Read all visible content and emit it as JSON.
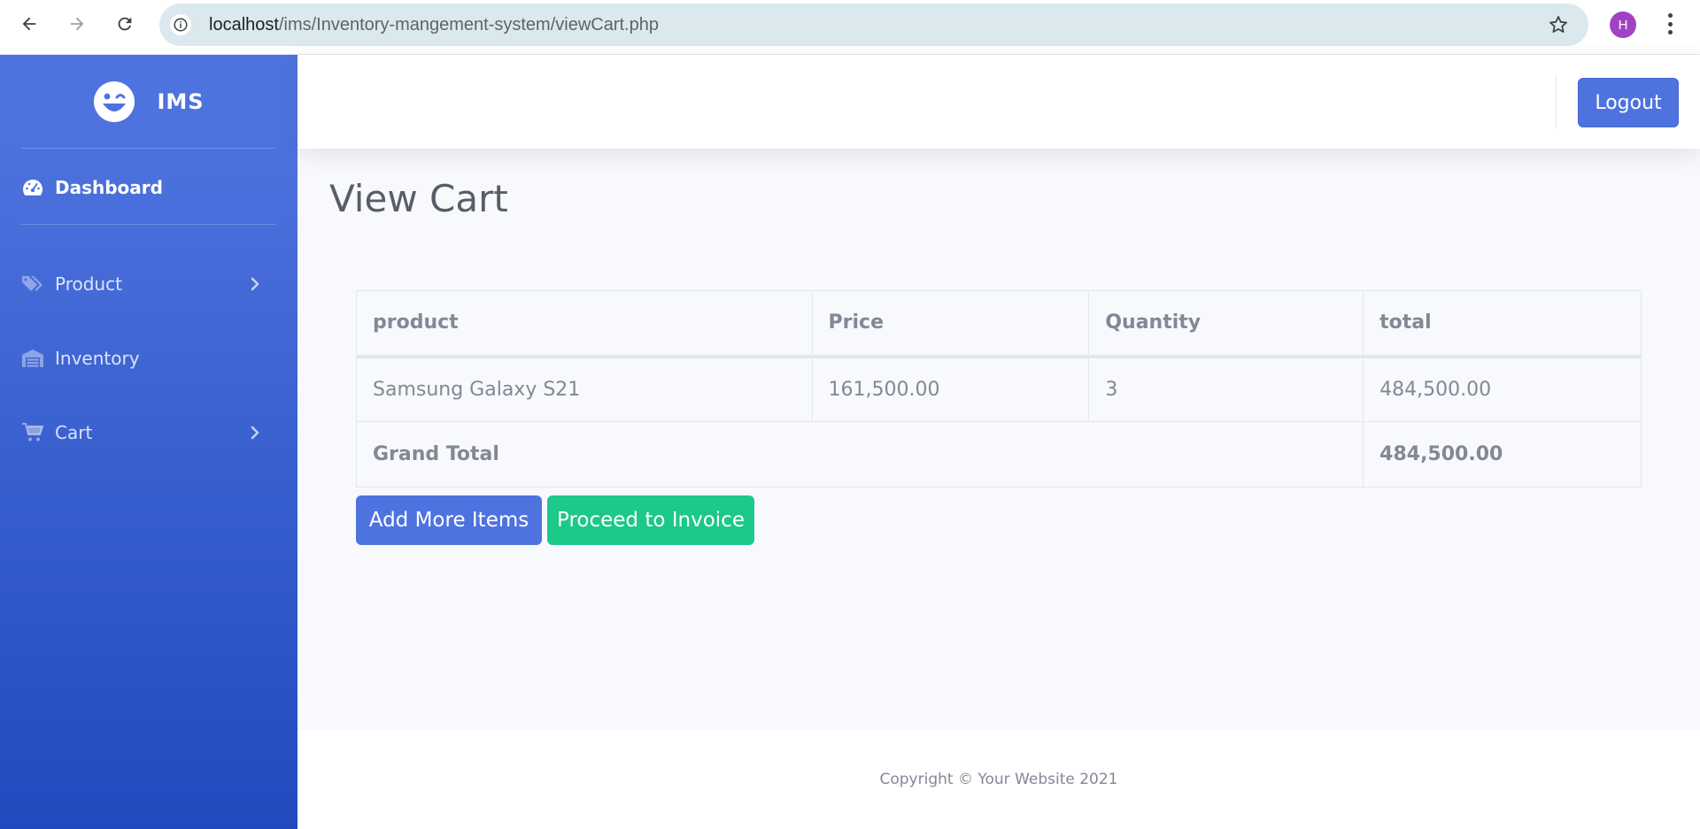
{
  "browser": {
    "url_host": "localhost",
    "url_path": "/ims/Inventory-mangement-system/viewCart.php",
    "profile_initial": "H"
  },
  "sidebar": {
    "brand": "IMS",
    "items": [
      {
        "label": "Dashboard",
        "icon": "tachometer-icon",
        "active": true
      },
      {
        "label": "Product",
        "icon": "tags-icon",
        "has_submenu": true
      },
      {
        "label": "Inventory",
        "icon": "warehouse-icon"
      },
      {
        "label": "Cart",
        "icon": "cart-icon",
        "has_submenu": true
      }
    ]
  },
  "topbar": {
    "logout_label": "Logout"
  },
  "main": {
    "title": "View Cart",
    "table": {
      "headers": [
        "product",
        "Price",
        "Quantity",
        "total"
      ],
      "rows": [
        {
          "product": "Samsung Galaxy S21",
          "price": "161,500.00",
          "quantity": "3",
          "total": "484,500.00"
        }
      ],
      "grand_total_label": "Grand Total",
      "grand_total_value": "484,500.00"
    },
    "buttons": {
      "add_more": "Add More Items",
      "proceed": "Proceed to Invoice"
    }
  },
  "footer": {
    "copyright": "Copyright © Your Website 2021"
  },
  "colors": {
    "primary": "#4e73df",
    "success": "#1cc88a",
    "text_muted": "#858796"
  }
}
